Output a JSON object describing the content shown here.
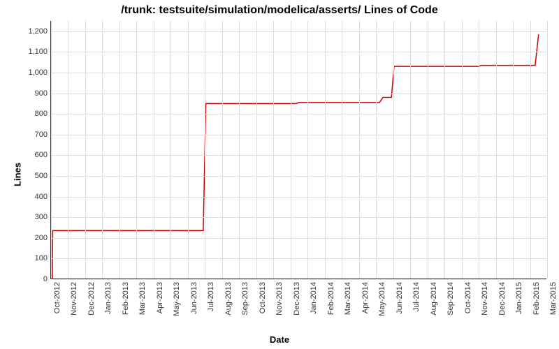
{
  "chart_data": {
    "type": "line",
    "title": "/trunk: testsuite/simulation/modelica/asserts/ Lines of Code",
    "xlabel": "Date",
    "ylabel": "Lines",
    "ylim": [
      0,
      1250
    ],
    "line_color": "#cc0000",
    "x_categories": [
      "Oct-2012",
      "Nov-2012",
      "Dec-2012",
      "Jan-2013",
      "Feb-2013",
      "Mar-2013",
      "Apr-2013",
      "May-2013",
      "Jun-2013",
      "Jul-2013",
      "Aug-2013",
      "Sep-2013",
      "Oct-2013",
      "Nov-2013",
      "Dec-2013",
      "Jan-2014",
      "Feb-2014",
      "Mar-2014",
      "Apr-2014",
      "May-2014",
      "Jun-2014",
      "Jul-2014",
      "Aug-2014",
      "Sep-2014",
      "Oct-2014",
      "Nov-2014",
      "Dec-2014",
      "Jan-2015",
      "Feb-2015",
      "Mar-2015"
    ],
    "y_ticks": [
      0,
      100,
      200,
      300,
      400,
      500,
      600,
      700,
      800,
      900,
      1000,
      1100,
      1200
    ],
    "series": [
      {
        "name": "Lines of Code",
        "points": [
          {
            "x": "Oct-2012",
            "xf": 0.08,
            "y": 0
          },
          {
            "x": "Oct-2012",
            "xf": 0.1,
            "y": 235
          },
          {
            "x": "Jun-2013",
            "xf": 8.9,
            "y": 235
          },
          {
            "x": "Jul-2013",
            "xf": 9.05,
            "y": 850
          },
          {
            "x": "Dec-2013",
            "xf": 14.3,
            "y": 850
          },
          {
            "x": "Jan-2014",
            "xf": 14.5,
            "y": 855
          },
          {
            "x": "May-2014",
            "xf": 19.2,
            "y": 855
          },
          {
            "x": "May-2014",
            "xf": 19.4,
            "y": 880
          },
          {
            "x": "Jun-2014",
            "xf": 19.9,
            "y": 880
          },
          {
            "x": "Jun-2014",
            "xf": 20.05,
            "y": 1030
          },
          {
            "x": "Nov-2014",
            "xf": 25.0,
            "y": 1030
          },
          {
            "x": "Nov-2014",
            "xf": 25.15,
            "y": 1035
          },
          {
            "x": "Feb-2015",
            "xf": 28.3,
            "y": 1035
          },
          {
            "x": "Feb-2015",
            "xf": 28.5,
            "y": 1185
          }
        ]
      }
    ]
  }
}
